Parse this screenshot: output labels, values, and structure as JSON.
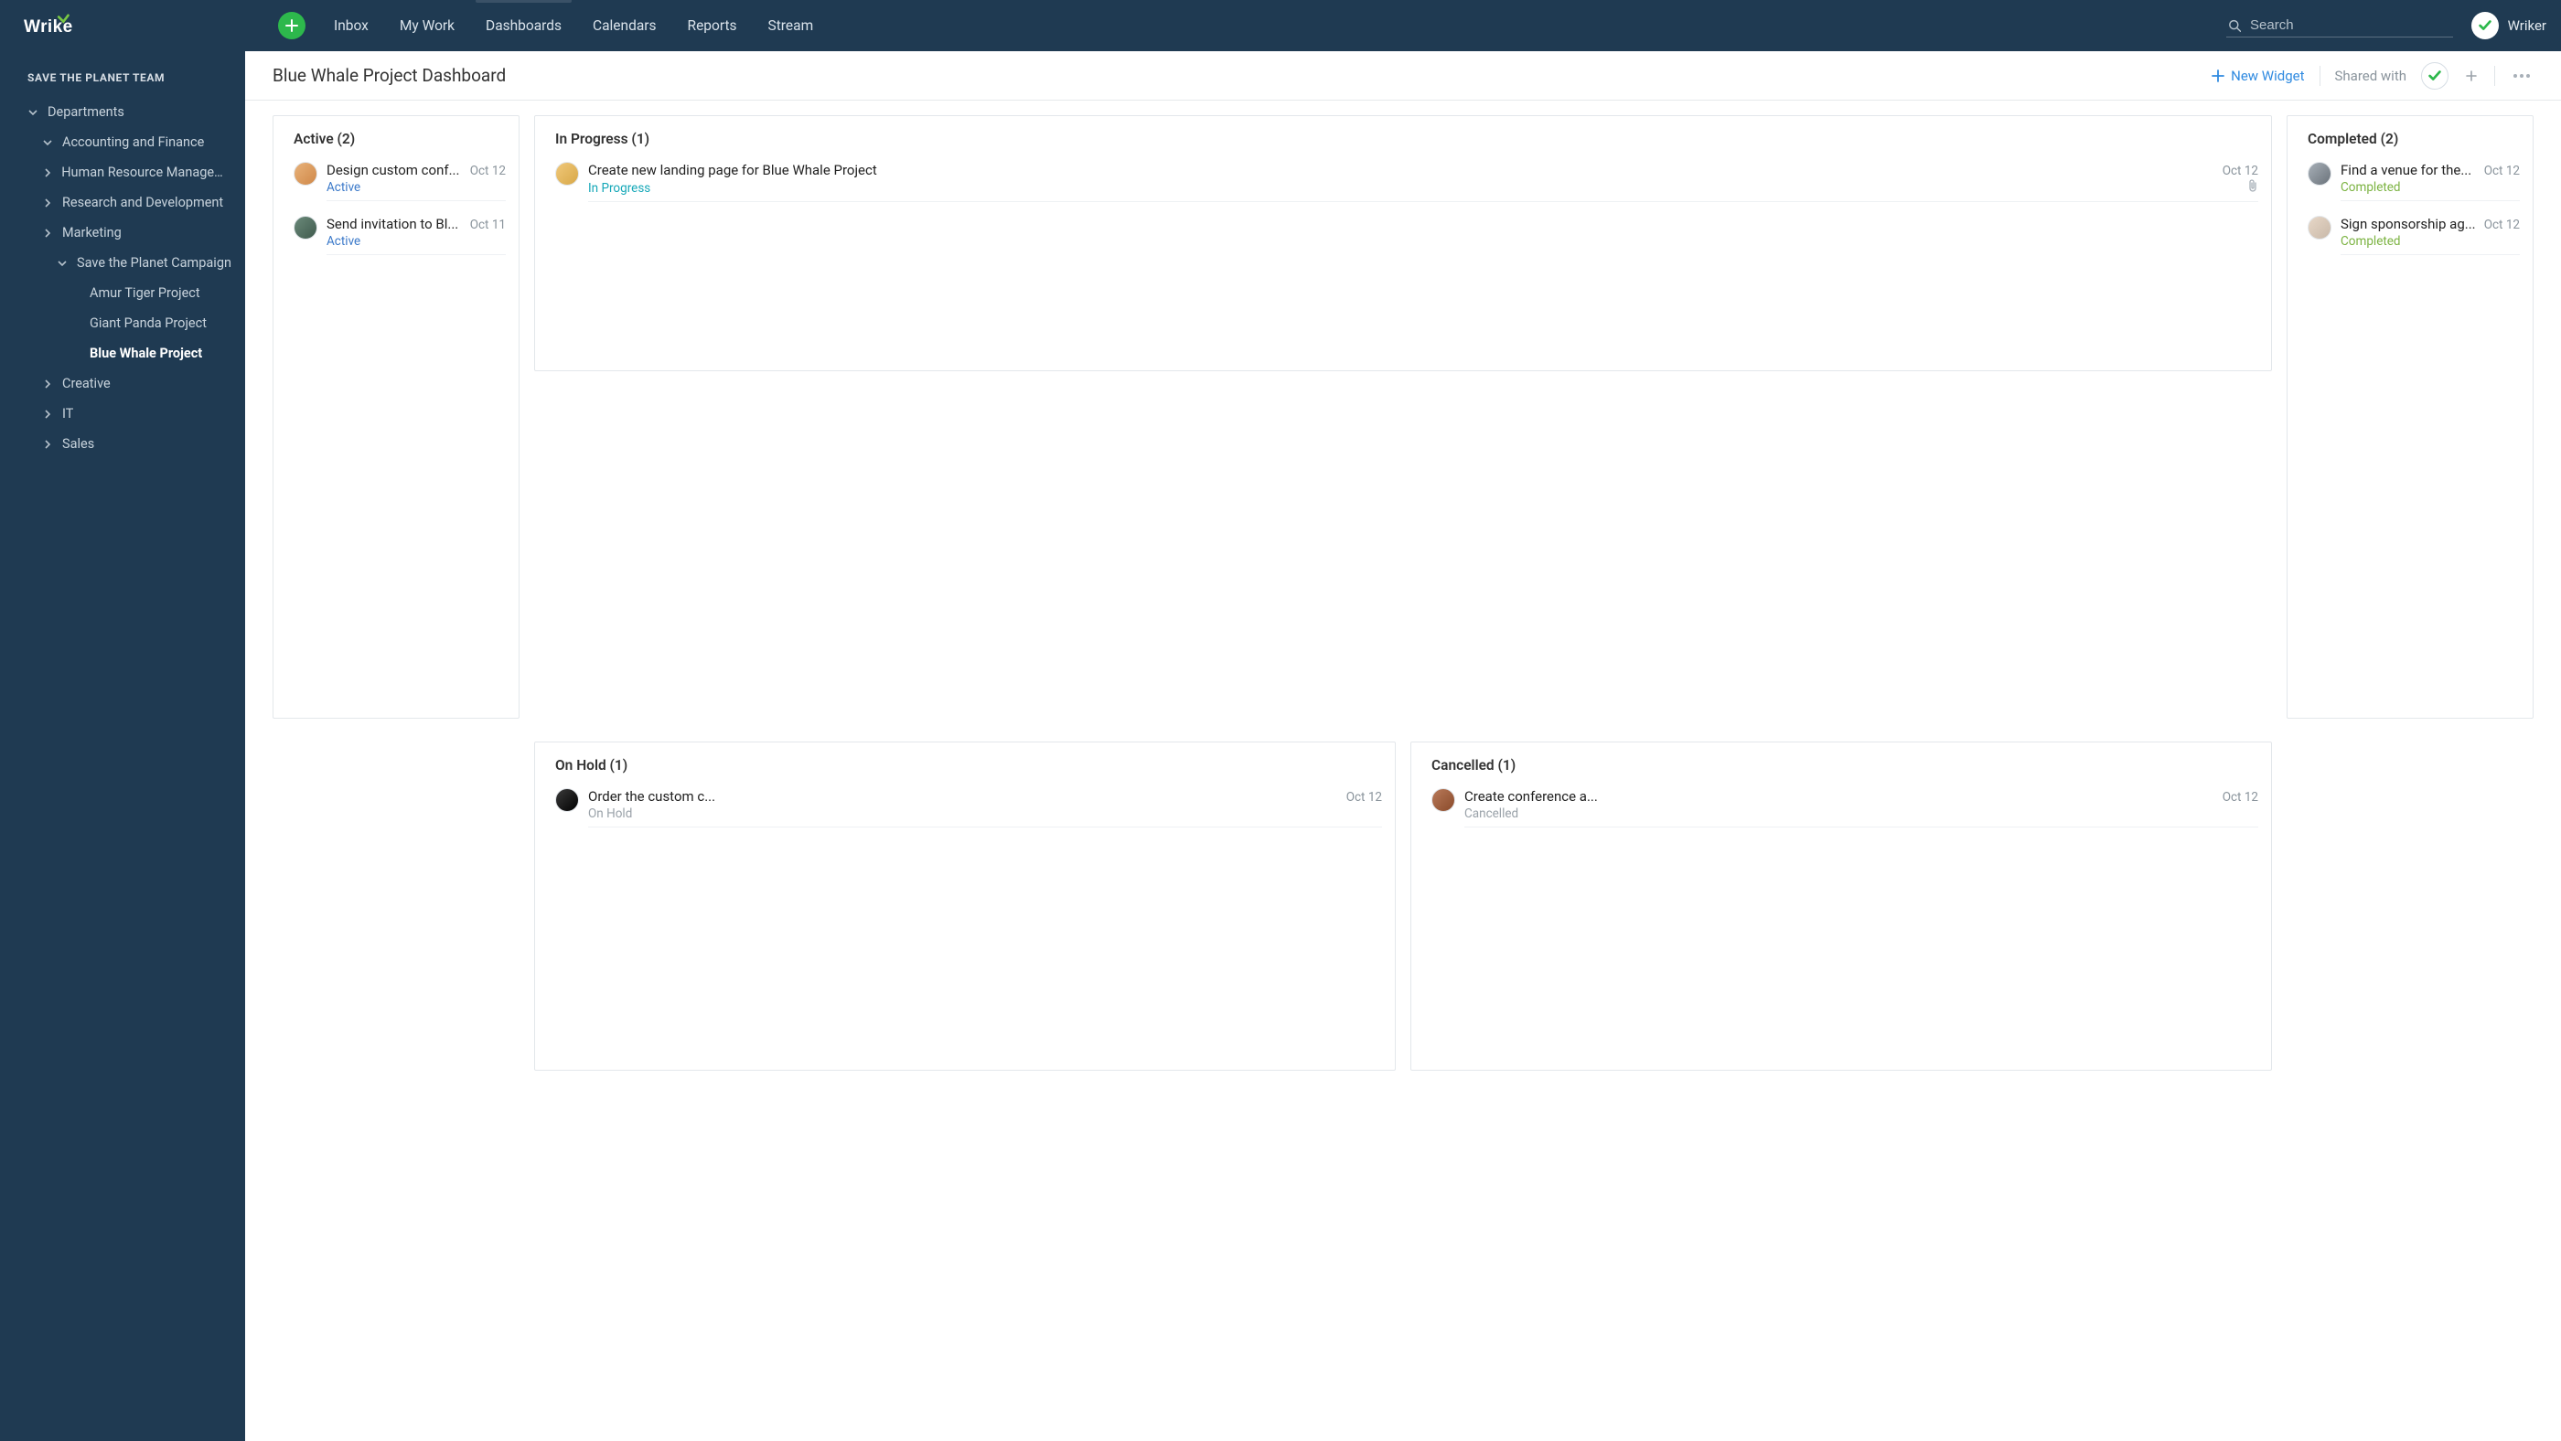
{
  "brand": "Wrike",
  "nav": {
    "items": [
      "Inbox",
      "My Work",
      "Dashboards",
      "Calendars",
      "Reports",
      "Stream"
    ],
    "activeIndex": 2
  },
  "search": {
    "placeholder": "Search"
  },
  "user": {
    "name": "Wriker"
  },
  "sidebar": {
    "team": "SAVE THE PLANET TEAM",
    "root": {
      "label": "Departments",
      "expanded": true
    },
    "departments": [
      {
        "label": "Accounting and Finance",
        "expanded": true,
        "children": []
      },
      {
        "label": "Human Resource Management",
        "expanded": false
      },
      {
        "label": "Research and Development",
        "expanded": false
      },
      {
        "label": "Marketing",
        "expanded": false,
        "sub": {
          "label": "Save the Planet Campaign",
          "expanded": true,
          "projects": [
            {
              "label": "Amur Tiger Project",
              "selected": false
            },
            {
              "label": "Giant Panda Project",
              "selected": false
            },
            {
              "label": "Blue Whale Project",
              "selected": true
            }
          ]
        }
      },
      {
        "label": "Creative",
        "expanded": false
      },
      {
        "label": "IT",
        "expanded": false
      },
      {
        "label": "Sales",
        "expanded": false
      }
    ]
  },
  "page": {
    "title": "Blue Whale Project Dashboard",
    "newWidgetLabel": "New Widget",
    "sharedWithLabel": "Shared with"
  },
  "widgets": {
    "active": {
      "title": "Active (2)",
      "tasks": [
        {
          "title": "Design custom conf...",
          "date": "Oct 12",
          "status": "Active",
          "statusClass": "st-active",
          "avatar": "av-a"
        },
        {
          "title": "Send invitation to Bl...",
          "date": "Oct 11",
          "status": "Active",
          "statusClass": "st-active",
          "avatar": "av-b"
        }
      ]
    },
    "inProgress": {
      "title": "In Progress (1)",
      "tasks": [
        {
          "title": "Create new landing page for Blue Whale Project",
          "date": "Oct 12",
          "status": "In Progress",
          "statusClass": "st-progress",
          "avatar": "av-c",
          "hasAttachment": true
        }
      ]
    },
    "onHold": {
      "title": "On Hold (1)",
      "tasks": [
        {
          "title": "Order the custom c...",
          "date": "Oct 12",
          "status": "On Hold",
          "statusClass": "st-hold",
          "avatar": "av-d"
        }
      ]
    },
    "cancelled": {
      "title": "Cancelled (1)",
      "tasks": [
        {
          "title": "Create conference a...",
          "date": "Oct 12",
          "status": "Cancelled",
          "statusClass": "st-cancelled",
          "avatar": "av-e"
        }
      ]
    },
    "completed": {
      "title": "Completed (2)",
      "tasks": [
        {
          "title": "Find a venue for the...",
          "date": "Oct 12",
          "status": "Completed",
          "statusClass": "st-completed",
          "avatar": "av-f"
        },
        {
          "title": "Sign sponsorship ag...",
          "date": "Oct 12",
          "status": "Completed",
          "statusClass": "st-completed",
          "avatar": "av-g"
        }
      ]
    }
  }
}
